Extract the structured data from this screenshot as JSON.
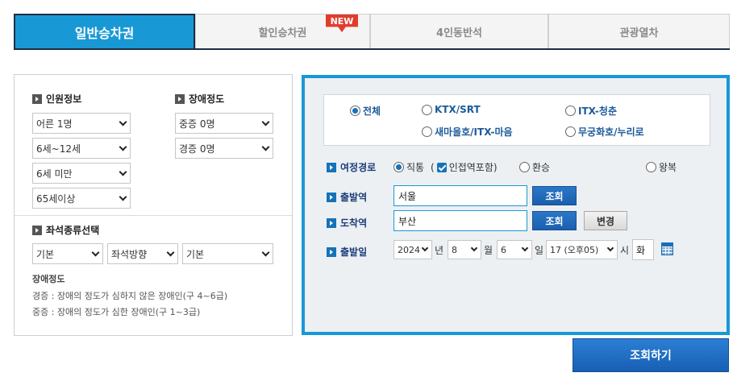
{
  "tabs": [
    {
      "label": "일반승차권",
      "active": true
    },
    {
      "label": "할인승차권",
      "active": false
    },
    {
      "label": "4인동반석",
      "active": false
    },
    {
      "label": "관광열차",
      "active": false
    }
  ],
  "new_badge": "NEW",
  "passengers": {
    "title": "인원정보",
    "adult": "어른 1명",
    "child": "6세~12세",
    "infant": "6세 미만",
    "senior": "65세이상"
  },
  "disability": {
    "title": "장애정도",
    "severe": "중증 0명",
    "mild": "경증 0명"
  },
  "seat": {
    "title": "좌석종류선택",
    "type": "기본",
    "direction": "좌석방향",
    "position": "기본"
  },
  "notes": {
    "title": "장애정도",
    "mild": "경증 : 장애의 정도가 심하지 않은 장애인(구 4~6급)",
    "severe": "중증 : 장애의 정도가 심한 장애인(구 1~3급)"
  },
  "train_types": {
    "all": "전체",
    "ktx": "KTX/SRT",
    "itx_cheongchun": "ITX-청춘",
    "saemaeul": "새마을호/ITX-마음",
    "mugunghwa": "무궁화호/누리로"
  },
  "route": {
    "label": "여정경로",
    "direct": "직통",
    "paren_open": "(",
    "nearby": "인접역포함)",
    "transfer": "환승",
    "roundtrip": "왕복"
  },
  "departure": {
    "label": "출발역",
    "value": "서울",
    "button": "조회"
  },
  "arrival": {
    "label": "도착역",
    "value": "부산",
    "button": "조회",
    "change_button": "변경"
  },
  "date": {
    "label": "출발일",
    "year": "2024",
    "year_unit": "년",
    "month": "8",
    "month_unit": "월",
    "day": "6",
    "day_unit": "일",
    "hour": "17 (오후05)",
    "hour_unit": "시",
    "weekday": "화"
  },
  "search_button": "조회하기",
  "colors": {
    "accent": "#1998d6",
    "navy": "#1b2d47",
    "button_blue": "#1a5fae",
    "badge_red": "#e23c2c"
  }
}
